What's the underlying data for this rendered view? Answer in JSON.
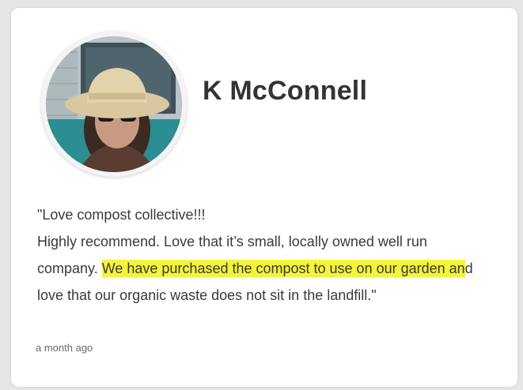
{
  "review": {
    "reviewer_name": "K McConnell",
    "text_line1": "\"Love compost collective!!!",
    "text_line2": "Highly recommend. Love that it’s small, locally owned well run",
    "text_line3_pre": "company. ",
    "text_line3_highlight": "We have purchased the compost to use on our garden an",
    "text_line3_post": "d",
    "text_line4": "love that our organic waste does not sit in the landfill.\"",
    "timestamp": "a month ago",
    "highlight_color": "#f4f43a"
  },
  "avatar": {
    "icon": "profile-photo",
    "description_colors": [
      "#b9c3c7",
      "#d9c8a2",
      "#2b2b2b"
    ]
  }
}
